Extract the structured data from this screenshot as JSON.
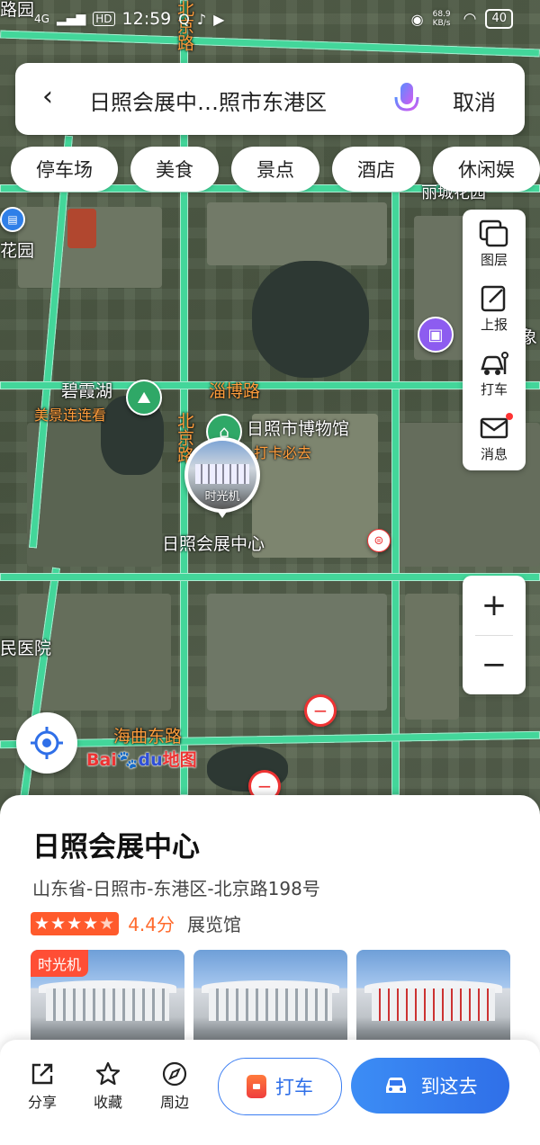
{
  "status_bar": {
    "time": "12:59",
    "network": "4G",
    "hd": "HD",
    "speed": "68.9 KB/s",
    "battery": "40"
  },
  "search": {
    "query": "日照会展中…照市东港区",
    "cancel_label": "取消"
  },
  "chips": [
    "停车场",
    "美食",
    "景点",
    "酒店",
    "休闲娱"
  ],
  "side_tools": [
    {
      "label": "图层",
      "icon": "layers-icon"
    },
    {
      "label": "上报",
      "icon": "report-icon"
    },
    {
      "label": "打车",
      "icon": "taxi-icon"
    },
    {
      "label": "消息",
      "icon": "message-icon"
    }
  ],
  "zoom": {
    "in": "+",
    "out": "−"
  },
  "map_labels": {
    "bixia_lake": "碧霞湖",
    "bixia_tag": "美景连连看",
    "museum": "日照市博物馆",
    "museum_tag": "打卡必去",
    "zibo_road": "淄博路",
    "beijing_road": "北京路",
    "beijing_road_top": "北京路",
    "expo_center": "日照会展中心",
    "time_machine": "时光机",
    "haiqu_east_road": "海曲东路",
    "hospital": "民医院",
    "garden_left": "花园",
    "garden_top": "丽城花园",
    "right_edge": "象",
    "top_left": "路园"
  },
  "logo": {
    "part1": "Bai",
    "part2": "du",
    "part3": "地图"
  },
  "place": {
    "name": "日照会展中心",
    "address": "山东省-日照市-东港区-北京路198号",
    "rating": "4.4分",
    "rating_value": 4.4,
    "category": "展览馆",
    "photo_tag": "时光机"
  },
  "actions": {
    "share": "分享",
    "favorite": "收藏",
    "nearby": "周边",
    "taxi": "打车",
    "go": "到这去"
  },
  "colors": {
    "accent": "#2f6fe8",
    "road": "#43d69a",
    "rating": "#ff5a2c"
  }
}
